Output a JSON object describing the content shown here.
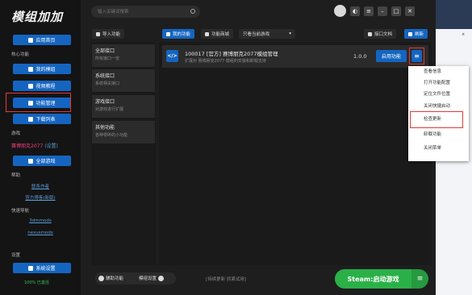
{
  "app": {
    "logo": "模组加加"
  },
  "sidebar": {
    "home_label": "应用首页",
    "core_section": "核心功能",
    "core_buttons": [
      "我的模组",
      "视频教程",
      "功能管理",
      "下载列表"
    ],
    "game_section": "游戏",
    "game_name": "赛博朋克2077",
    "game_settings": "(设置)",
    "all_games_label": "全部游戏",
    "help_section": "帮助",
    "help_links": [
      "联系作者",
      "官方博客(新版)"
    ],
    "fast_section": "快速导航",
    "fast_links": [
      "3dmmods",
      "nexusmods"
    ],
    "settings_section": "设置",
    "system_settings_label": "系统设置",
    "status_text": "100% 已激活"
  },
  "topbar": {
    "search_placeholder": "输入关键词搜索",
    "icons": [
      "theme-icon",
      "menu-icon",
      "minimize-icon",
      "maximize-icon",
      "close-icon"
    ],
    "glyphs": [
      "◐",
      "≡",
      "–",
      "□",
      "✕"
    ]
  },
  "toolbar": {
    "import_label": "导入功能",
    "my_features_label": "我的功能",
    "feature_store_label": "功能商城",
    "filter_select": "只看当前游戏",
    "docs_label": "接口文档",
    "refresh_label": "刷新"
  },
  "categories": [
    {
      "title": "全部接口",
      "desc": "所有接口一览"
    },
    {
      "title": "系统接口",
      "desc": "系统相关接口"
    },
    {
      "title": "游戏接口",
      "desc": "对游戏进行扩展"
    },
    {
      "title": "其他功能",
      "desc": "各种零碎的小功能"
    }
  ],
  "mod": {
    "icon_text": "</>",
    "title": "100017 [官方] 赛博朋克2077模组管理",
    "desc": "扩展对 赛博朋克2077 模组的安装和卸载支持",
    "version": "1.0.0",
    "enable_label": "启用功能",
    "menu_glyph": "≡"
  },
  "context_menu": [
    "查看信息",
    "打开功能配置",
    "定位文件位置",
    "关闭快捷启动",
    "检查更新",
    "卸载功能",
    "关闭菜单"
  ],
  "bottom": {
    "aux_label": "辅助功能",
    "mod_settings_label": "模组设置",
    "hint": "[持续更新 抓紧试用]",
    "steam_label": "Steam:启动游戏",
    "steam_menu_glyph": "≡"
  },
  "accent_colors": {
    "primary": "#1565c0",
    "highlight": "#e53935",
    "steam": "#2bb048",
    "game": "#ff3d7f"
  }
}
